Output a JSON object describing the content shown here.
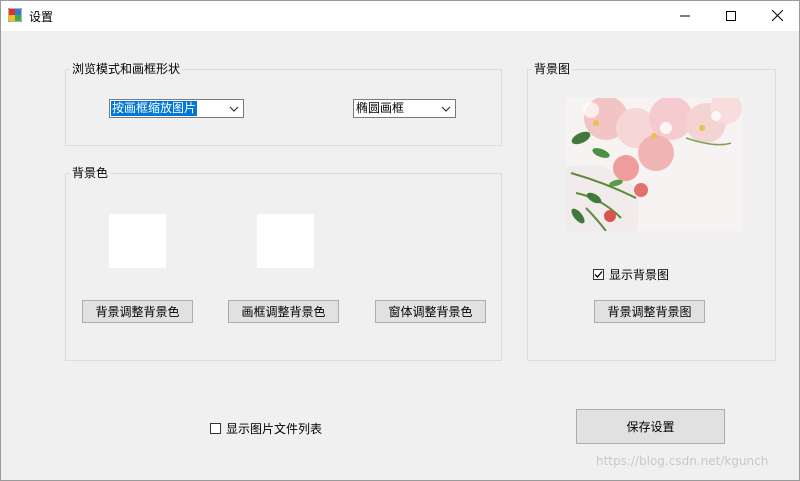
{
  "window": {
    "title": "设置",
    "icon": "app-icon"
  },
  "browse_group": {
    "label": "浏览模式和画框形状",
    "mode_value": "按画框缩放图片",
    "shape_value": "椭圆画框"
  },
  "bgcolor_group": {
    "label": "背景色",
    "swatch_colors": [
      "#ffffff",
      "#ffffff"
    ],
    "buttons": {
      "background": "背景调整背景色",
      "frame": "画框调整背景色",
      "window": "窗体调整背景色"
    }
  },
  "bgimage_group": {
    "label": "背景图",
    "show_label": "显示背景图",
    "show_checked": true,
    "adjust_button": "背景调整背景图"
  },
  "show_filelist": {
    "label": "显示图片文件列表",
    "checked": false
  },
  "save_button": "保存设置",
  "watermark": "https://blog.csdn.net/kgunch"
}
